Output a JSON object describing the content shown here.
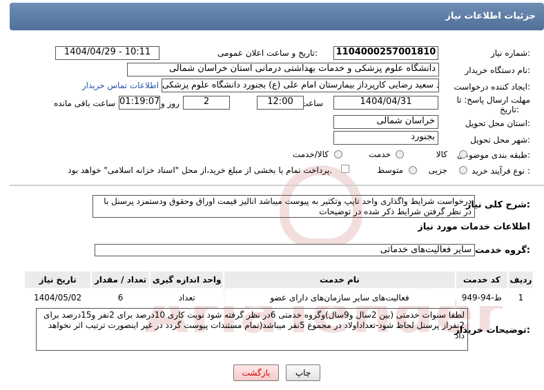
{
  "header": {
    "title": "جزئیات اطلاعات نیاز"
  },
  "form": {
    "need_number_label": "شماره نیاز:",
    "need_number": "1104000257001810",
    "announce_label": "تاریخ و ساعت اعلان عمومی:",
    "announce_value": "1404/04/29 - 10:11",
    "buyer_label": "نام دستگاه خریدار:",
    "buyer_value": "دانشگاه علوم پزشکی و خدمات بهداشتی درمانی استان خراسان شمالی",
    "creator_label": "ایجاد کننده درخواست:",
    "creator_value": "سید سعید رضایی کارپرداز بیمارستان امام علی (ع) بجنورد دانشگاه علوم پزشکی",
    "contact_link": "اطلاعات تماس خریدار",
    "deadline_label_1": "مهلت ارسال پاسخ: تا",
    "deadline_label_2": "تاریخ:",
    "deadline_date": "1404/04/31",
    "time_label": "ساعت",
    "deadline_time": "12:00",
    "days_value": "2",
    "days_label": "روز و",
    "remaining_time": "01:19:07",
    "remaining_label": "ساعت باقی مانده",
    "province_label": "استان محل تحویل:",
    "province_value": "خراسان شمالی",
    "city_label": "شهر محل تحویل:",
    "city_value": "بجنورد",
    "category_label": "طبقه بندی موضوعی:",
    "category_options": [
      "کالا",
      "خدمت",
      "کالا/خدمت"
    ],
    "process_label": "نوع فرآیند خرید :",
    "process_options": [
      "جزیی",
      "متوسط"
    ],
    "payment_note": "پرداخت تمام یا بخشی از مبلغ خرید،از محل \"اسناد خزانه اسلامی\" خواهد بود."
  },
  "description": {
    "label": "شرح کلی نیاز:",
    "text": "درخواست شرایط واگذاری واحد تایپ وتکثیر به پیوست میباشد انالیز قیمت اوراق وحقوق ودستمزد پرسنل با در نظر گرفتن شرایط ذکر شده در توضیحات"
  },
  "services": {
    "section_title": "اطلاعات خدمات مورد نیاز",
    "group_label": "گروه خدمت:",
    "group_value": "سایر فعالیت‌های خدماتی",
    "columns": [
      "ردیف",
      "کد خدمت",
      "نام خدمت",
      "واحد اندازه گیری",
      "تعداد / مقدار",
      "تاریخ نیاز"
    ],
    "rows": [
      {
        "row": "1",
        "code": "ط-94-949",
        "name": "فعالیت‌های سایر سازمان‌های دارای عضو",
        "unit": "تعداد",
        "qty": "6",
        "date": "1404/05/02"
      }
    ]
  },
  "buyer_notes": {
    "label": "توضیحات خریدار:",
    "text": "لطفا سنوات خدمتی (بین 2سال و9سال)وگروه خدمتی 6در نظر گرفته شود نوبت کاری 10درصد برای 2نفر و15درصد برای 2نفراز پرسنل لحاظ شود-تعداداولاد در مجموع 5نفر میباشد(تمام مستندات پیوست گردد در غیر اینصورت ترتیب اثر نخواهد داد"
  },
  "buttons": {
    "print": "چاپ",
    "back": "بازگشت"
  },
  "colors": {
    "header": "#5b7ba3",
    "back_button_text": "#cc0000",
    "link": "#2255aa"
  }
}
